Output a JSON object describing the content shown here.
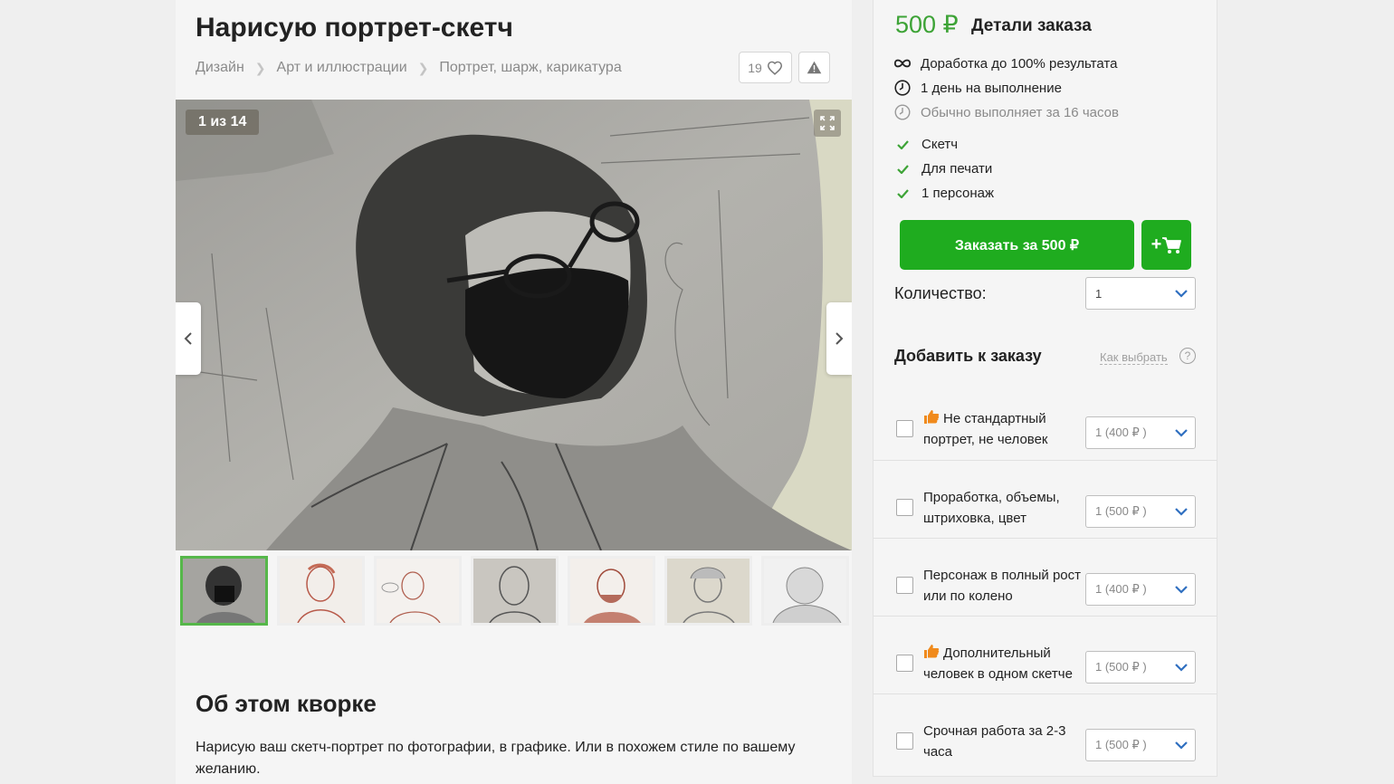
{
  "gig": {
    "title": "Нарисую портрет-скетч",
    "breadcrumbs": [
      "Дизайн",
      "Арт и иллюстрации",
      "Портрет, шарж, карикатура"
    ],
    "likes": "19"
  },
  "gallery": {
    "counter": "1 из 14",
    "thumbnail_count": 7,
    "active_index": 0
  },
  "about": {
    "heading": "Об этом кворке",
    "text": "Нарисую ваш скетч-портрет по фотографии, в графике. Или в похожем стиле по вашему желанию."
  },
  "order": {
    "price": "500 ₽",
    "details_heading": "Детали заказа",
    "features": [
      {
        "icon": "infinity-icon",
        "text": "Доработка до 100% результата"
      },
      {
        "icon": "clock-icon",
        "text": "1 день на выполнение"
      },
      {
        "icon": "clock-icon",
        "text": "Обычно выполняет за 16 часов"
      }
    ],
    "included": [
      "Скетч",
      "Для печати",
      "1 персонаж"
    ],
    "order_button": "Заказать за 500 ₽",
    "cart_button": "+",
    "quantity_label": "Количество:",
    "quantity_value": "1",
    "add_heading": "Добавить к заказу",
    "how_to_choose": "Как выбрать",
    "help_icon": "?"
  },
  "extras": [
    {
      "label": "Не стандартный портрет, не человек",
      "recommended": true,
      "option": "1 (400 ₽ )"
    },
    {
      "label": "Проработка, объемы, штриховка, цвет",
      "recommended": false,
      "option": "1 (500 ₽ )"
    },
    {
      "label": "Персонаж в полный рост или по колено",
      "recommended": false,
      "option": "1 (400 ₽ )"
    },
    {
      "label": "Дополнительный человек в одном скетче",
      "recommended": true,
      "option": "1 (500 ₽ )"
    },
    {
      "label": "Срочная работа за 2-3 часа",
      "recommended": false,
      "option": "1 (500 ₽ )"
    }
  ],
  "colors": {
    "accent_green": "#1fac1f",
    "price_green": "#3da336",
    "thumb_active_border": "#56b74a",
    "recommend_orange": "#f08a1c"
  }
}
